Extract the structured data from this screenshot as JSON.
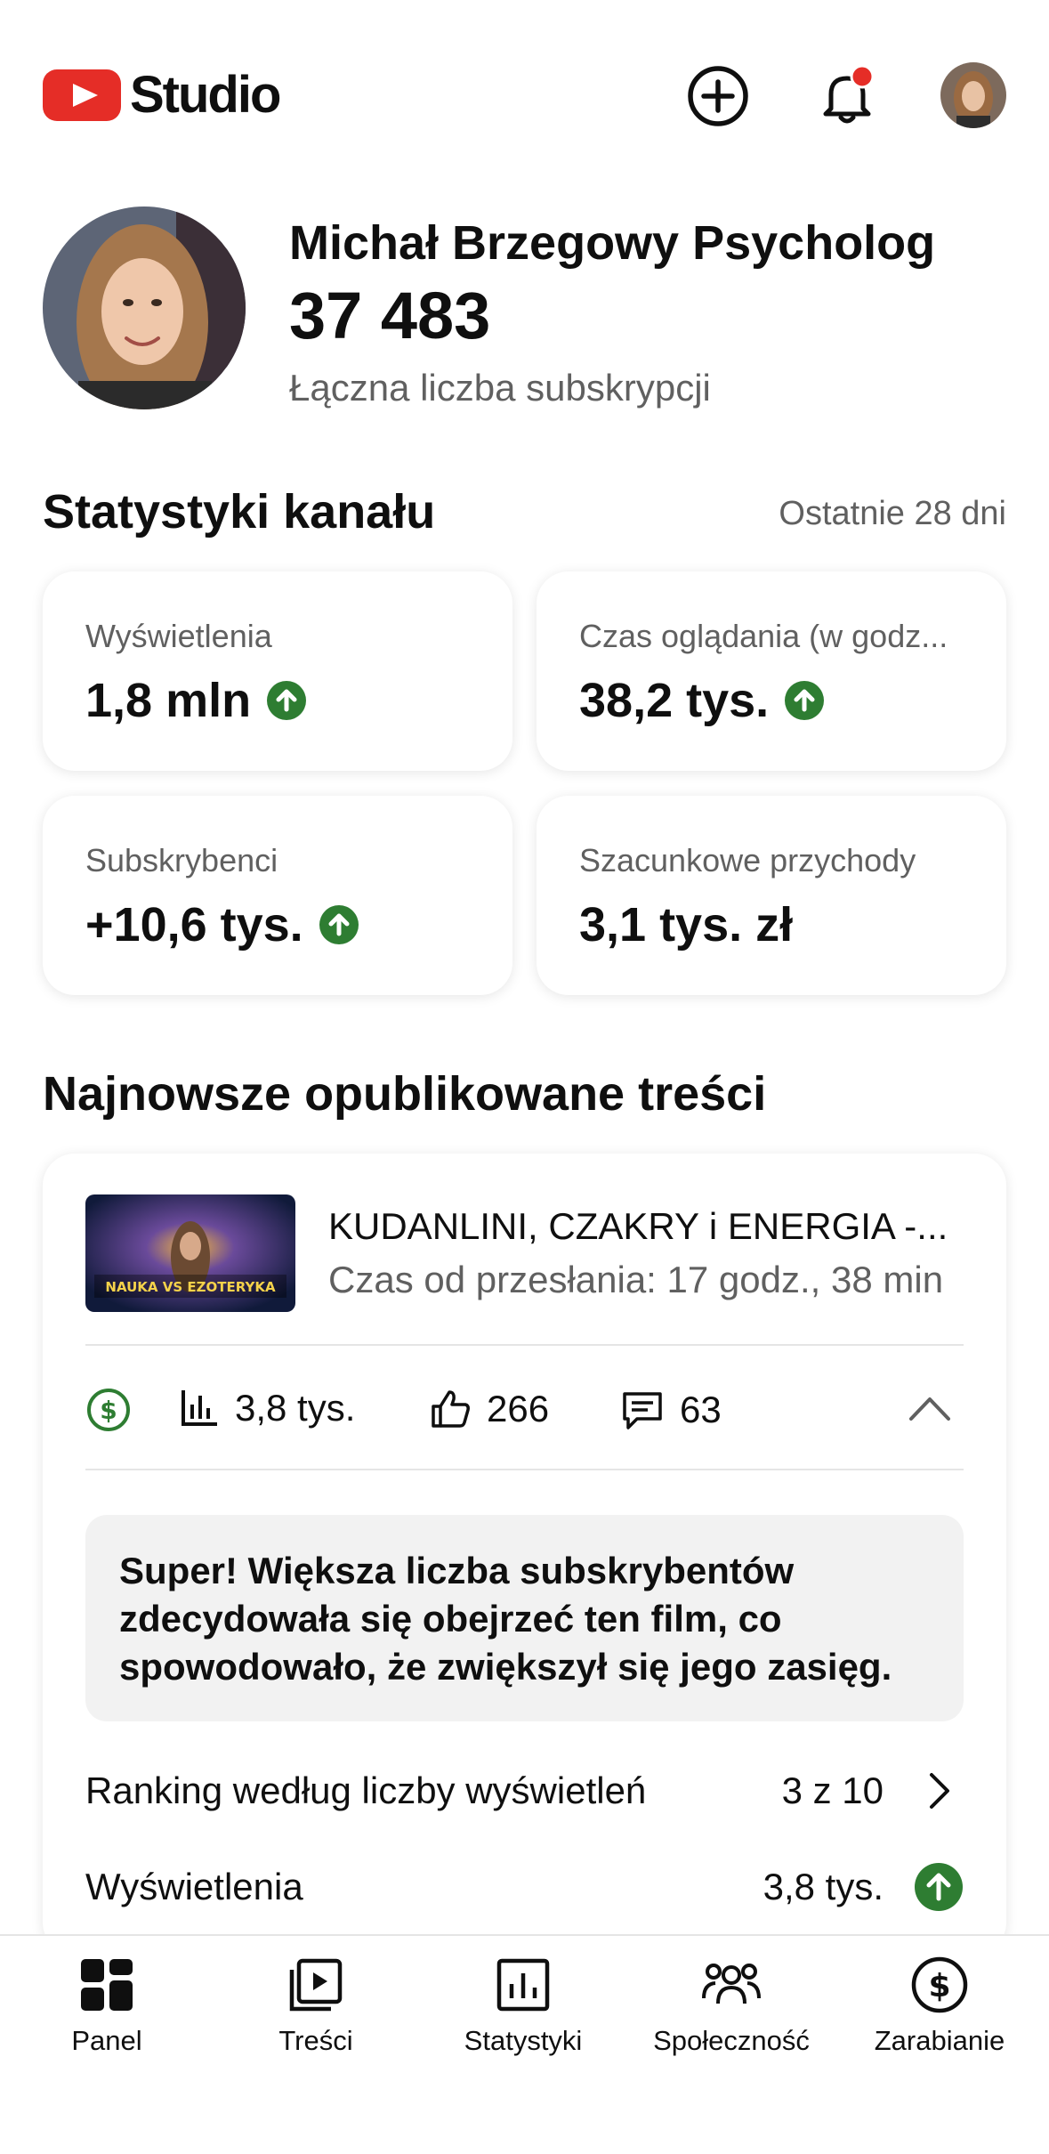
{
  "app": {
    "logo_text": "Studio"
  },
  "header": {
    "create_icon": "add-circle-icon",
    "notifications_icon": "bell-icon",
    "notification_dot_color": "#e52d27"
  },
  "channel": {
    "name": "Michał Brzegowy Psycholog",
    "subscribers": "37 483",
    "subscribers_label": "Łączna liczba subskrypcji"
  },
  "stats": {
    "title": "Statystyki kanału",
    "period": "Ostatnie 28 dni",
    "cards": [
      {
        "label": "Wyświetlenia",
        "value": "1,8 mln",
        "trend": "up"
      },
      {
        "label": "Czas oglądania (w godz...",
        "value": "38,2 tys.",
        "trend": "up"
      },
      {
        "label": "Subskrybenci",
        "value": "+10,6 tys.",
        "trend": "up"
      },
      {
        "label": "Szacunkowe przychody",
        "value": "3,1 tys. zł",
        "trend": "none"
      }
    ],
    "trend_color": "#2e7d32"
  },
  "latest": {
    "title": "Najnowsze opublikowane treści",
    "video": {
      "title": "KUDANLINI, CZAKRY i ENERGIA -...",
      "uploaded": "Czas od przesłania: 17 godz., 38 min",
      "thumbnail_text": "NAUKA VS EZOTERYKA"
    },
    "metrics": {
      "views": "3,8 tys.",
      "likes": "266",
      "comments": "63"
    },
    "insight": "Super! Większa liczba subskrybentów zdecydowała się obejrzeć ten film, co spowodowało, że zwiększył się jego zasięg.",
    "rows": [
      {
        "label": "Ranking według liczby wyświetleń",
        "value": "3 z 10"
      },
      {
        "label": "Wyświetlenia",
        "value": "3,8 tys."
      }
    ]
  },
  "nav": [
    {
      "label": "Panel",
      "icon": "dashboard-icon"
    },
    {
      "label": "Treści",
      "icon": "content-icon"
    },
    {
      "label": "Statystyki",
      "icon": "analytics-icon"
    },
    {
      "label": "Społeczność",
      "icon": "community-icon"
    },
    {
      "label": "Zarabianie",
      "icon": "earn-icon"
    }
  ]
}
